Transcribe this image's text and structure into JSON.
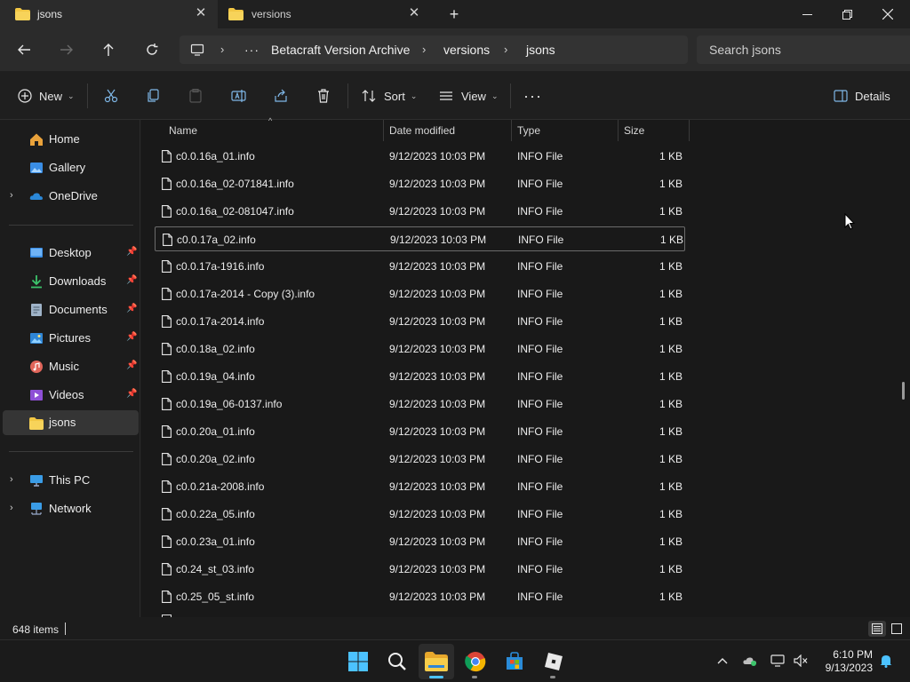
{
  "tabs": [
    {
      "label": "jsons",
      "active": true
    },
    {
      "label": "versions",
      "active": false
    }
  ],
  "breadcrumb": {
    "items": [
      "Betacraft Version Archive",
      "versions",
      "jsons"
    ]
  },
  "search": {
    "placeholder": "Search jsons"
  },
  "commandbar": {
    "new_label": "New",
    "sort_label": "Sort",
    "view_label": "View",
    "details_label": "Details"
  },
  "sidebar": {
    "items": [
      {
        "label": "Home",
        "icon": "home-icon"
      },
      {
        "label": "Gallery",
        "icon": "gallery-icon"
      },
      {
        "label": "OneDrive",
        "icon": "onedrive-icon"
      },
      {
        "label": "Desktop",
        "icon": "desktop-icon",
        "pinned": true
      },
      {
        "label": "Downloads",
        "icon": "downloads-icon",
        "pinned": true
      },
      {
        "label": "Documents",
        "icon": "documents-icon",
        "pinned": true
      },
      {
        "label": "Pictures",
        "icon": "pictures-icon",
        "pinned": true
      },
      {
        "label": "Music",
        "icon": "music-icon",
        "pinned": true
      },
      {
        "label": "Videos",
        "icon": "videos-icon",
        "pinned": true
      },
      {
        "label": "jsons",
        "icon": "folder-icon",
        "selected": true
      },
      {
        "label": "This PC",
        "icon": "this-pc-icon"
      },
      {
        "label": "Network",
        "icon": "network-icon"
      }
    ]
  },
  "columns": [
    "Name",
    "Date modified",
    "Type",
    "Size"
  ],
  "files": [
    {
      "name": "c0.0.16a_01.info",
      "date": "9/12/2023 10:03 PM",
      "type": "INFO File",
      "size": "1 KB"
    },
    {
      "name": "c0.0.16a_02-071841.info",
      "date": "9/12/2023 10:03 PM",
      "type": "INFO File",
      "size": "1 KB"
    },
    {
      "name": "c0.0.16a_02-081047.info",
      "date": "9/12/2023 10:03 PM",
      "type": "INFO File",
      "size": "1 KB"
    },
    {
      "name": "c0.0.17a_02.info",
      "date": "9/12/2023 10:03 PM",
      "type": "INFO File",
      "size": "1 KB",
      "focused": true
    },
    {
      "name": "c0.0.17a-1916.info",
      "date": "9/12/2023 10:03 PM",
      "type": "INFO File",
      "size": "1 KB"
    },
    {
      "name": "c0.0.17a-2014 - Copy (3).info",
      "date": "9/12/2023 10:03 PM",
      "type": "INFO File",
      "size": "1 KB"
    },
    {
      "name": "c0.0.17a-2014.info",
      "date": "9/12/2023 10:03 PM",
      "type": "INFO File",
      "size": "1 KB"
    },
    {
      "name": "c0.0.18a_02.info",
      "date": "9/12/2023 10:03 PM",
      "type": "INFO File",
      "size": "1 KB"
    },
    {
      "name": "c0.0.19a_04.info",
      "date": "9/12/2023 10:03 PM",
      "type": "INFO File",
      "size": "1 KB"
    },
    {
      "name": "c0.0.19a_06-0137.info",
      "date": "9/12/2023 10:03 PM",
      "type": "INFO File",
      "size": "1 KB"
    },
    {
      "name": "c0.0.20a_01.info",
      "date": "9/12/2023 10:03 PM",
      "type": "INFO File",
      "size": "1 KB"
    },
    {
      "name": "c0.0.20a_02.info",
      "date": "9/12/2023 10:03 PM",
      "type": "INFO File",
      "size": "1 KB"
    },
    {
      "name": "c0.0.21a-2008.info",
      "date": "9/12/2023 10:03 PM",
      "type": "INFO File",
      "size": "1 KB"
    },
    {
      "name": "c0.0.22a_05.info",
      "date": "9/12/2023 10:03 PM",
      "type": "INFO File",
      "size": "1 KB"
    },
    {
      "name": "c0.0.23a_01.info",
      "date": "9/12/2023 10:03 PM",
      "type": "INFO File",
      "size": "1 KB"
    },
    {
      "name": "c0.24_st_03.info",
      "date": "9/12/2023 10:03 PM",
      "type": "INFO File",
      "size": "1 KB"
    },
    {
      "name": "c0.25_05_st.info",
      "date": "9/12/2023 10:03 PM",
      "type": "INFO File",
      "size": "1 KB"
    }
  ],
  "status": {
    "item_count": "648 items"
  },
  "clock": {
    "time": "6:10 PM",
    "date": "9/13/2023"
  },
  "colors": {
    "folder": "#f2c744",
    "accent": "#4cc2ff",
    "background": "#191919"
  }
}
